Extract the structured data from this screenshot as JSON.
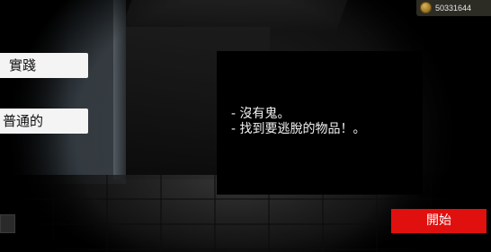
{
  "currency": {
    "icon": "coin-icon",
    "amount": "50331644"
  },
  "modes": {
    "practice_label": "實踐",
    "normal_label": "普通的"
  },
  "description": {
    "lines": [
      "- 沒有鬼。",
      "- 找到要逃脫的物品！。"
    ]
  },
  "actions": {
    "start_label": "開始"
  },
  "colors": {
    "start_button": "#e0100f",
    "mode_button_bg": "#f4f4f4",
    "coin": "#c9a24a"
  }
}
